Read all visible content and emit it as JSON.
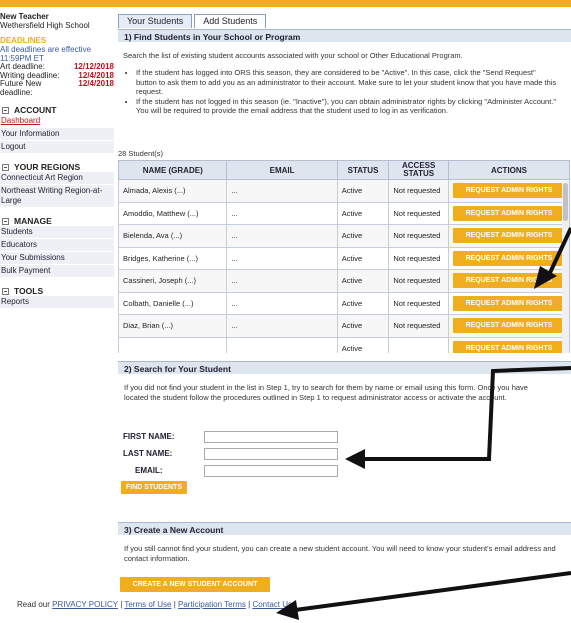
{
  "colors": {
    "accent": "#f0ad1e",
    "deadline_date": "#b5121b",
    "link": "#3b5aa0",
    "panel_header": "#dde5ef"
  },
  "sidebar": {
    "user_name": "New Teacher",
    "school": "Wethersfield High School",
    "deadlines_heading": "DEADLINES",
    "deadlines_note": "All deadlines are effective 11:59PM ET",
    "deadlines": [
      {
        "label": "Art deadline:",
        "date": "12/12/2018"
      },
      {
        "label": "Writing deadline:",
        "date": "12/4/2018"
      },
      {
        "label": "Future New",
        "date": "12/4/2018"
      },
      {
        "label": "deadline:",
        "date": ""
      }
    ],
    "account": {
      "heading": "ACCOUNT",
      "items": [
        "Dashboard",
        "Your Information",
        "Logout"
      ]
    },
    "regions": {
      "heading": "YOUR REGIONS",
      "items": [
        "Connecticut Art Region",
        "Northeast Writing Region-at-Large"
      ]
    },
    "manage": {
      "heading": "MANAGE",
      "items": [
        "Students",
        "Educators",
        "Your Submissions",
        "Bulk Payment"
      ]
    },
    "tools": {
      "heading": "TOOLS",
      "items": [
        "Reports"
      ]
    }
  },
  "tabs": [
    "Your Students",
    "Add Students"
  ],
  "step1": {
    "title": "1) Find Students in Your School or Program",
    "intro": "Search the list of existing student accounts associated with your school or Other Educational Program.",
    "bullets": [
      "If the student has logged into ORS this season, they are considered to be \"Active\". In this case, click the \"Send Request\" button to ask them to add you as an administrator to their account. Make sure to let your student know that you have made this request.",
      "If the student has not logged in this season (ie. \"Inactive\"), you can obtain administrator rights by clicking \"Administer Account.\" You will be required to provide the email address that the student used to log in as verification."
    ],
    "count": "28 Student(s)",
    "columns": [
      "NAME (GRADE)",
      "EMAIL",
      "STATUS",
      "ACCESS STATUS",
      "ACTIONS"
    ],
    "rows": [
      {
        "name": "Almada, Alexis (...)",
        "email": "...",
        "status": "Active",
        "access": "Not requested",
        "action": "REQUEST ADMIN RIGHTS"
      },
      {
        "name": "Amoddio, Matthew (...)",
        "email": "...",
        "status": "Active",
        "access": "Not requested",
        "action": "REQUEST ADMIN RIGHTS"
      },
      {
        "name": "Bielenda, Ava (...)",
        "email": "...",
        "status": "Active",
        "access": "Not requested",
        "action": "REQUEST ADMIN RIGHTS"
      },
      {
        "name": "Bridges, Katherine (...)",
        "email": "...",
        "status": "Active",
        "access": "Not requested",
        "action": "REQUEST ADMIN RIGHTS"
      },
      {
        "name": "Cassineri, Joseph (...)",
        "email": "...",
        "status": "Active",
        "access": "Not requested",
        "action": "REQUEST ADMIN RIGHTS"
      },
      {
        "name": "Colbath, Danielle (...)",
        "email": "...",
        "status": "Active",
        "access": "Not requested",
        "action": "REQUEST ADMIN RIGHTS"
      },
      {
        "name": "Diaz, Brian (...)",
        "email": "...",
        "status": "Active",
        "access": "Not requested",
        "action": "REQUEST ADMIN RIGHTS"
      },
      {
        "name": "",
        "email": "",
        "status": "Active",
        "access": "",
        "action": "REQUEST ADMIN RIGHTS"
      }
    ]
  },
  "step2": {
    "title": "2) Search for Your Student",
    "text": "If you did not find your student in the list in Step 1, try to search for them by name or email using this form. Once you have located the student follow the procedures outlined in Step 1 to request administrator access or activate the account.",
    "first_name_label": "FIRST NAME:",
    "last_name_label": "LAST NAME:",
    "email_label": "EMAIL:",
    "first_name_value": "",
    "last_name_value": "",
    "email_value": "",
    "button": "FIND STUDENTS"
  },
  "step3": {
    "title": "3) Create a New Account",
    "text": "If you still cannot find your student, you can create a new student account. You will need to know your student's email address and contact information.",
    "button": "CREATE A NEW STUDENT ACCOUNT"
  },
  "footer": {
    "prefix": "Read our",
    "links": [
      "PRIVACY POLICY",
      "Terms of Use",
      "Participation Terms",
      "Contact Us"
    ]
  }
}
